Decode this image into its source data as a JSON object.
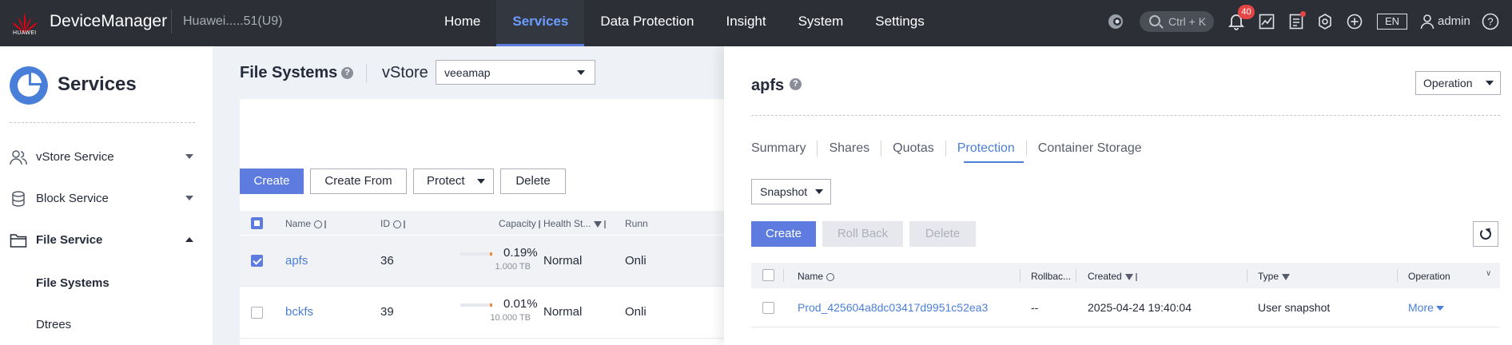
{
  "topbar": {
    "brand": "HUAWEI",
    "app_title": "DeviceManager",
    "device": "Huawei.....51(U9)",
    "nav": [
      "Home",
      "Services",
      "Data Protection",
      "Insight",
      "System",
      "Settings"
    ],
    "active_nav": "Services",
    "search_shortcut": "Ctrl + K",
    "notification_count": "40",
    "language": "EN",
    "user": "admin"
  },
  "sidebar": {
    "title": "Services",
    "items": [
      {
        "label": "vStore Service"
      },
      {
        "label": "Block Service"
      },
      {
        "label": "File Service"
      }
    ],
    "subitems": [
      "File Systems",
      "Dtrees"
    ]
  },
  "main": {
    "title": "File Systems",
    "vstore_label": "vStore",
    "vstore_value": "veeamap",
    "buttons": {
      "create": "Create",
      "create_from": "Create From",
      "protect": "Protect",
      "delete": "Delete"
    },
    "columns": {
      "name": "Name",
      "id": "ID",
      "capacity": "Capacity",
      "health": "Health St...",
      "running": "Runn"
    },
    "rows": [
      {
        "name": "apfs",
        "id": "36",
        "capacity_pct": "0.19%",
        "capacity_total": "1.000 TB",
        "health": "Normal",
        "running": "Onli"
      },
      {
        "name": "bckfs",
        "id": "39",
        "capacity_pct": "0.01%",
        "capacity_total": "10.000 TB",
        "health": "Normal",
        "running": "Onli"
      }
    ]
  },
  "drawer": {
    "title": "apfs",
    "operation": "Operation",
    "tabs": [
      "Summary",
      "Shares",
      "Quotas",
      "Protection",
      "Container Storage"
    ],
    "active_tab": "Protection",
    "snapshot_select": "Snapshot",
    "buttons": {
      "create": "Create",
      "rollback": "Roll Back",
      "delete": "Delete"
    },
    "columns": {
      "name": "Name",
      "rollback": "Rollbac...",
      "created": "Created",
      "type": "Type",
      "operation": "Operation"
    },
    "rows": [
      {
        "name": "Prod_425604a8dc03417d9951c52ea3",
        "rollback": "--",
        "created": "2025-04-24 19:40:04",
        "type": "User snapshot",
        "operation": "More"
      }
    ]
  },
  "colors": {
    "topbar": "#2c2f36",
    "accent": "#5e7ce0",
    "link": "#4a7fd9",
    "badge": "#e54545"
  }
}
